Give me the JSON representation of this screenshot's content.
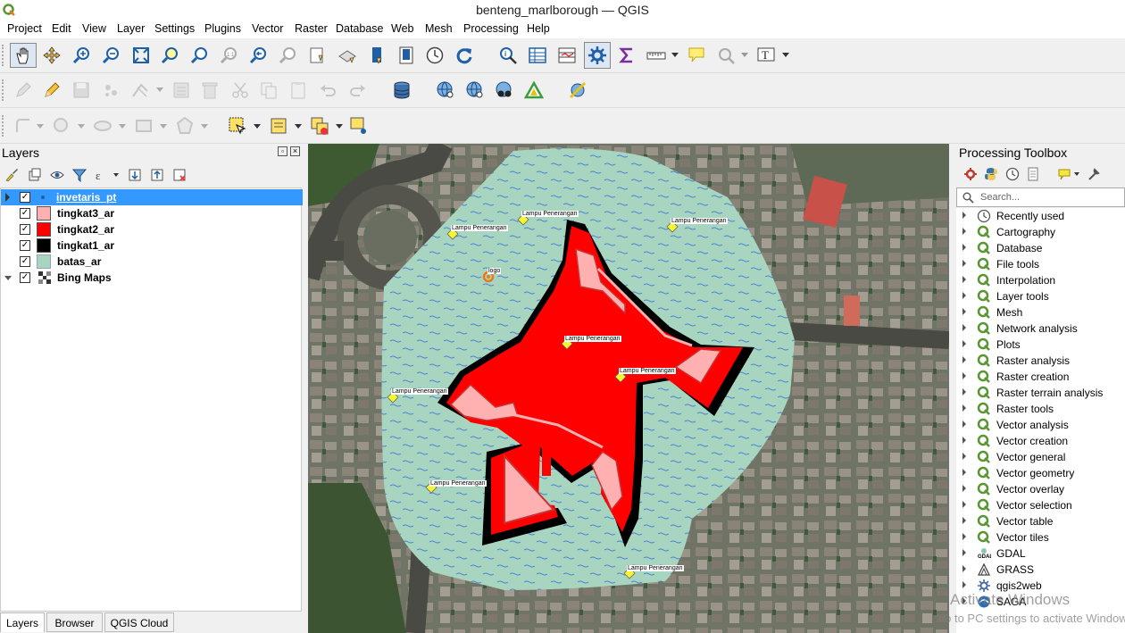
{
  "window": {
    "title": "benteng_marlborough — QGIS"
  },
  "menu": [
    "Project",
    "Edit",
    "View",
    "Layer",
    "Settings",
    "Plugins",
    "Vector",
    "Raster",
    "Database",
    "Web",
    "Mesh",
    "Processing",
    "Help"
  ],
  "layers_panel": {
    "title": "Layers",
    "layers": [
      {
        "name": "invetaris_pt",
        "checked": true,
        "selected": true,
        "swatch": "point"
      },
      {
        "name": "tingkat3_ar",
        "checked": true,
        "swatch": "#ffb0b0"
      },
      {
        "name": "tingkat2_ar",
        "checked": true,
        "swatch": "#ff0000"
      },
      {
        "name": "tingkat1_ar",
        "checked": true,
        "swatch": "#000000"
      },
      {
        "name": "batas_ar",
        "checked": true,
        "swatch": "#a8d5c0"
      },
      {
        "name": "Bing Maps",
        "checked": true,
        "swatch": "raster"
      }
    ]
  },
  "bottom_tabs": [
    "Layers",
    "Browser",
    "QGIS Cloud"
  ],
  "map": {
    "labels": [
      "Lampu Penerangan",
      "Lampu Penerangan",
      "Lampu Penerangan",
      "Lampu Penerangan",
      "Lampu Penerangan",
      "Lampu Penerangan",
      "Lampu Penerangan",
      "Lampu Penerangan"
    ],
    "logo_label": "logo"
  },
  "toolbox": {
    "title": "Processing Toolbox",
    "search_placeholder": "Search...",
    "items": [
      "Recently used",
      "Cartography",
      "Database",
      "File tools",
      "Interpolation",
      "Layer tools",
      "Mesh",
      "Network analysis",
      "Plots",
      "Raster analysis",
      "Raster creation",
      "Raster terrain analysis",
      "Raster tools",
      "Vector analysis",
      "Vector creation",
      "Vector general",
      "Vector geometry",
      "Vector overlay",
      "Vector selection",
      "Vector table",
      "Vector tiles",
      "GDAL",
      "GRASS",
      "qgis2web",
      "SAGA"
    ]
  },
  "watermark": {
    "line1": "Activate Windows",
    "line2": "Go to PC settings to activate Windows."
  }
}
